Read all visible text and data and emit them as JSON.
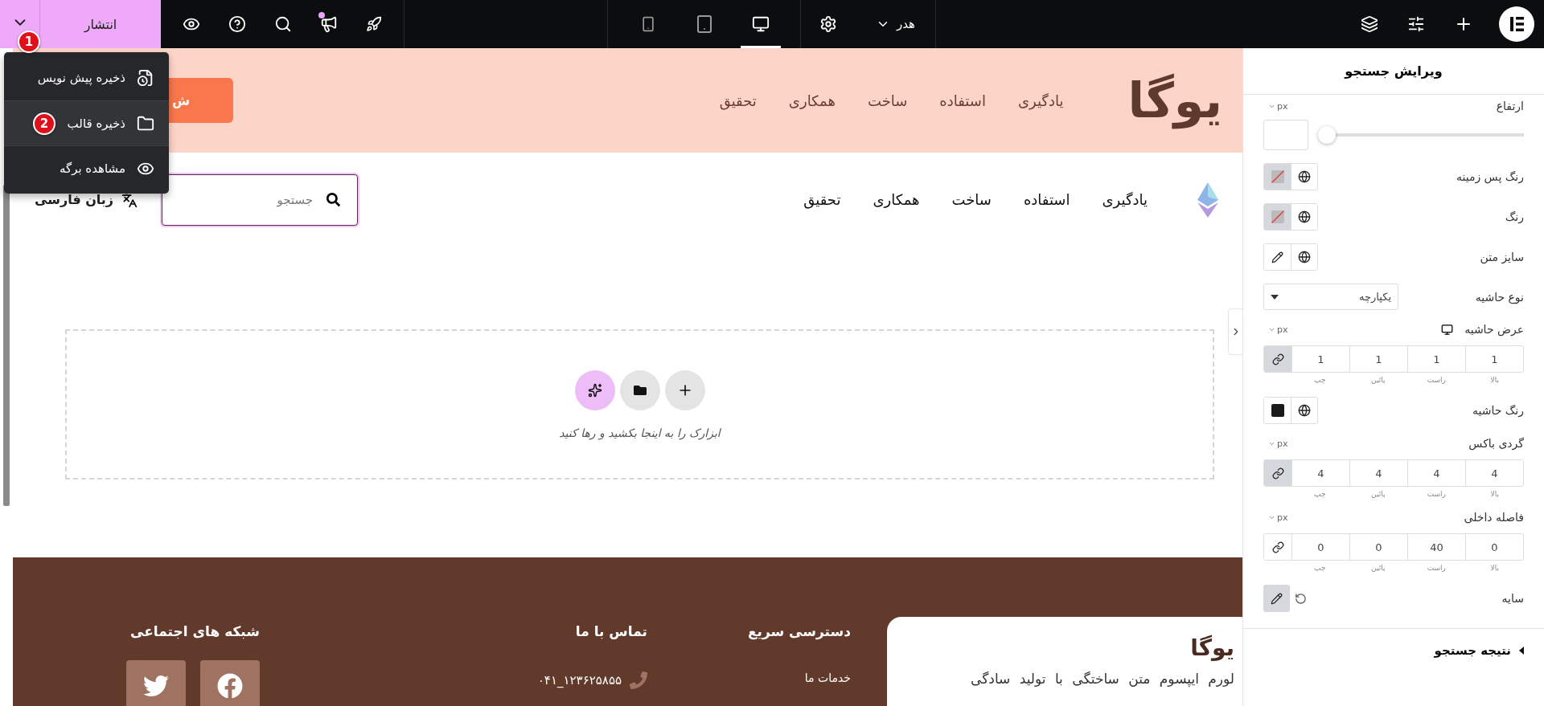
{
  "topbar": {
    "publish": {
      "label": "انتشار",
      "badge": "1"
    },
    "devices": [
      {
        "kind": "mobile",
        "selected": false
      },
      {
        "kind": "tablet",
        "selected": false
      },
      {
        "kind": "desktop",
        "selected": true
      }
    ],
    "document": {
      "label": "هدر"
    }
  },
  "save_menu": {
    "items": [
      {
        "kind": "draft",
        "label": "ذخیره پیش نویس",
        "highlighted": false
      },
      {
        "kind": "template",
        "label": "ذخیره قالب",
        "highlighted": true,
        "badge": "2"
      },
      {
        "kind": "view",
        "label": "مشاهده برگه",
        "highlighted": false
      }
    ]
  },
  "header": {
    "logo": "یوگا",
    "nav": [
      "یادگیری",
      "استفاده",
      "ساخت",
      "همکاری",
      "تحقیق"
    ],
    "button": "ش"
  },
  "menu_row": {
    "nav": [
      "یادگیری",
      "استفاده",
      "ساخت",
      "همکاری",
      "تحقیق"
    ],
    "search": {
      "placeholder": "جستجو"
    },
    "language": "زبان فارسی"
  },
  "drop_zone": {
    "hint": "ابزارک را به اینجا بکشید و رها کنید"
  },
  "footer": {
    "card": {
      "title": "یوگا",
      "text": "لورم ایپسوم متن ساختگی با تولید سادگی"
    },
    "columns": [
      {
        "kind": "links",
        "title": "دسترسی سریع",
        "links": [
          "خدمات ما"
        ]
      },
      {
        "kind": "contact",
        "title": "تماس با ما",
        "phone": "۰۴۱_۱۲۳۶۲۵۸۵۵"
      },
      {
        "kind": "social",
        "title": "شبکه های اجتماعی",
        "networks": [
          {
            "kind": "facebook"
          },
          {
            "kind": "twitter"
          }
        ]
      }
    ]
  },
  "panel": {
    "title": "ویرایش جستجو",
    "controls": [
      {
        "kind": "slider",
        "label": "ارتفاع",
        "unit": "px",
        "level": 0
      },
      {
        "kind": "color",
        "label": "رنگ پس زمینه",
        "set": false
      },
      {
        "kind": "color",
        "label": "رنگ",
        "set": false
      },
      {
        "kind": "typography",
        "label": "سایز متن"
      },
      {
        "kind": "select",
        "label": "نوع حاشیه",
        "value": "یکپارچه"
      },
      {
        "kind": "dimensions",
        "label": "عرض حاشیه",
        "unit": "px",
        "responsive": true,
        "linked": true,
        "values": [
          "1",
          "1",
          "1",
          "1"
        ],
        "sides": [
          "بالا",
          "راست",
          "پائین",
          "چپ"
        ]
      },
      {
        "kind": "color",
        "label": "رنگ حاشیه",
        "set": true
      },
      {
        "kind": "dimensions",
        "label": "گردی باکس",
        "unit": "px",
        "linked": true,
        "values": [
          "4",
          "4",
          "4",
          "4"
        ],
        "sides": [
          "بالا",
          "راست",
          "پائین",
          "چپ"
        ]
      },
      {
        "kind": "dimensions",
        "label": "فاصله داخلی",
        "unit": "px",
        "linked": false,
        "values": [
          "0",
          "40",
          "0",
          "0"
        ],
        "sides": [
          "بالا",
          "راست",
          "پائین",
          "چپ"
        ]
      },
      {
        "kind": "shadow",
        "label": "سایه",
        "active": true
      }
    ],
    "section": {
      "label": "نتیجه جستجو",
      "expanded": false
    }
  }
}
